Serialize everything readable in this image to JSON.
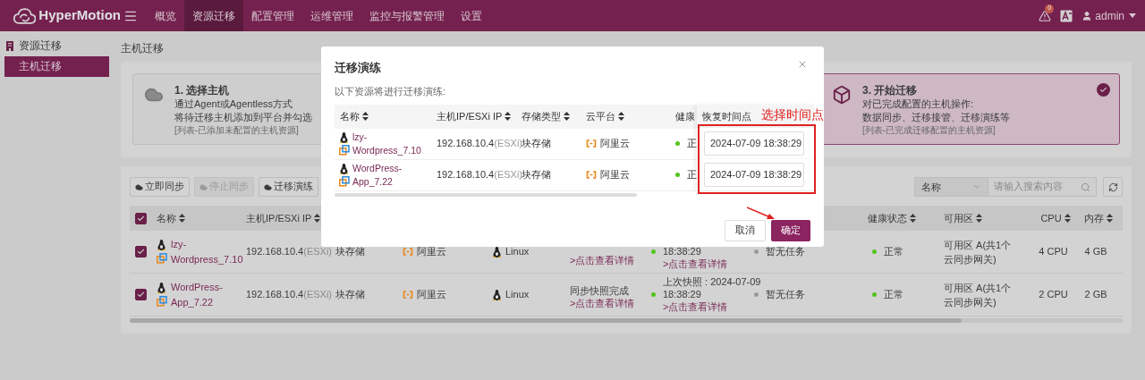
{
  "header": {
    "logo": "HyperMotion",
    "nav": [
      {
        "label": "概览",
        "selected": false
      },
      {
        "label": "资源迁移",
        "selected": true
      },
      {
        "label": "配置管理",
        "selected": false
      },
      {
        "label": "运维管理",
        "selected": false
      },
      {
        "label": "监控与报警管理",
        "selected": false
      },
      {
        "label": "设置",
        "selected": false
      }
    ],
    "alert_count": "0",
    "user": "admin"
  },
  "sidebar": {
    "section": "资源迁移",
    "items": [
      {
        "label": "主机迁移",
        "selected": true
      }
    ]
  },
  "page_title": "主机迁移",
  "steps": [
    {
      "title": "1. 选择主机",
      "lines": [
        "通过Agent或Agentless方式",
        "将待迁移主机添加到平台并勾选"
      ],
      "note": "[列表-已添加未配置的主机资源]",
      "selected": false
    },
    {
      "title": "3. 开始迁移",
      "lines": [
        "对已完成配置的主机操作:",
        "数据同步、迁移接管、迁移演练等"
      ],
      "note": "[列表-已完成迁移配置的主机资源]",
      "selected": true
    }
  ],
  "toolbar": {
    "buttons": [
      {
        "label": "立即同步",
        "disabled": false
      },
      {
        "label": "停止同步",
        "disabled": true
      },
      {
        "label": "迁移演练",
        "disabled": false
      }
    ],
    "filter_field": "名称",
    "search": {
      "placeholder": "请输入搜索内容"
    }
  },
  "table": {
    "all_checked": true,
    "header_left": [
      "名称",
      "主机IP/ESXi IP"
    ],
    "header_right": [
      "健康状态",
      "可用区",
      "CPU",
      "内存"
    ],
    "rows": [
      {
        "checked": true,
        "name": "lzy-Wordpress_7.10",
        "ip": "192.168.10.4",
        "ip_suffix": "(ESXi)",
        "storage": "块存储",
        "cloud": "阿里云",
        "os": "Linux",
        "sync": [
          {
            "text": ">点击查看详情",
            "kind": "link"
          }
        ],
        "snapshot": {
          "color": "#52c41a",
          "lines": [
            {
              "text": "18:38:29",
              "kind": "text"
            },
            {
              "text": ">点击查看详情",
              "kind": "link"
            }
          ]
        },
        "task": {
          "label": "暂无任务",
          "color": "#9a9a9a"
        },
        "health": {
          "label": "正常",
          "color": "#52c41a"
        },
        "zone": "可用区 A(共1个云同步网关)",
        "cpu": "4 CPU",
        "memory": "4 GB"
      },
      {
        "checked": true,
        "name": "WordPress-App_7.22",
        "ip": "192.168.10.4",
        "ip_suffix": "(ESXi)",
        "storage": "块存储",
        "cloud": "阿里云",
        "os": "Linux",
        "sync": [
          {
            "text": "同步快照完成",
            "kind": "text"
          },
          {
            "text": ">点击查看详情",
            "kind": "link"
          }
        ],
        "snapshot": {
          "color": "#52c41a",
          "lines": [
            {
              "text": "上次快照 : 2024-07-09",
              "kind": "text"
            },
            {
              "text": "18:38:29",
              "kind": "text"
            },
            {
              "text": ">点击查看详情",
              "kind": "link"
            }
          ]
        },
        "task": {
          "label": "暂无任务",
          "color": "#9a9a9a"
        },
        "health": {
          "label": "正常",
          "color": "#52c41a"
        },
        "zone": "可用区 A(共1个云同步网关)",
        "cpu": "2 CPU",
        "memory": "2 GB"
      }
    ]
  },
  "dialog": {
    "title": "迁移演练",
    "subtitle": "以下资源将进行迁移演练:",
    "columns": [
      "名称",
      "主机IP/ESXi IP",
      "存储类型",
      "云平台",
      "健康",
      "恢复时间点"
    ],
    "rows": [
      {
        "name": "lzy-Wordpress_7.10",
        "ip": "192.168.10.4",
        "ip_suffix": "(ESXi)",
        "storage": "块存储",
        "cloud": "阿里云",
        "health": {
          "label": "正",
          "color": "#52c41a"
        },
        "restore_point": "2024-07-09 18:38:29"
      },
      {
        "name": "WordPress-App_7.22",
        "ip": "192.168.10.4",
        "ip_suffix": "(ESXi)",
        "storage": "块存储",
        "cloud": "阿里云",
        "health": {
          "label": "正",
          "color": "#52c41a"
        },
        "restore_point": "2024-07-09 18:38:29"
      }
    ],
    "buttons": [
      {
        "label": "取消",
        "kind": "secondary"
      },
      {
        "label": "确定",
        "kind": "primary"
      }
    ]
  },
  "annotation": {
    "label": "选择时间点"
  }
}
